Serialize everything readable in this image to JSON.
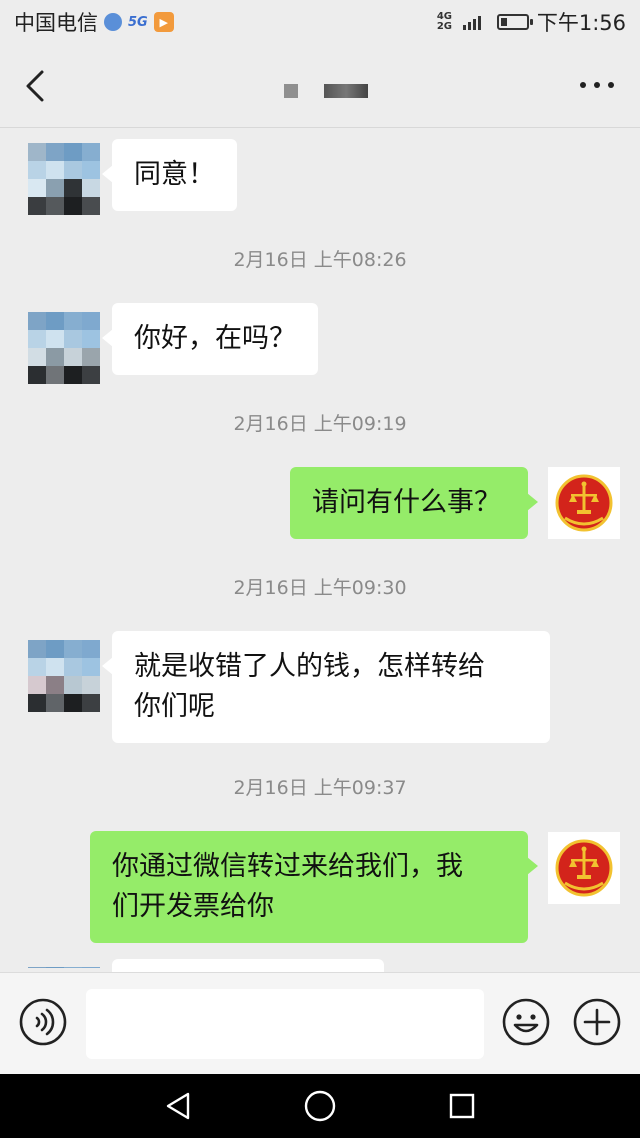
{
  "status_bar": {
    "carrier": "中国电信",
    "network_top": "4G",
    "network_bottom": "2G",
    "time": "下午1:56",
    "battery_level": 0.25
  },
  "header": {
    "back_icon": "chevron-left-icon",
    "more_icon": "more-dots-icon"
  },
  "messages": [
    {
      "side": "in",
      "text": "同意！"
    },
    {
      "type": "time",
      "text": "2月16日 上午08:26"
    },
    {
      "side": "in",
      "text": "你好，在吗？"
    },
    {
      "type": "time",
      "text": "2月16日 上午09:19"
    },
    {
      "side": "out",
      "text": "请问有什么事？"
    },
    {
      "type": "time",
      "text": "2月16日 上午09:30"
    },
    {
      "side": "in",
      "line1": "就是收错了人的钱，怎样转给",
      "line2": "你们呢"
    },
    {
      "type": "time",
      "text": "2月16日 上午09:37"
    },
    {
      "side": "out",
      "line1": "你通过微信转过来给我们，我",
      "line2": "们开发票给你"
    }
  ],
  "input_bar": {
    "voice_icon": "voice-icon",
    "input_value": "",
    "emoji_icon": "emoji-icon",
    "plus_icon": "plus-icon"
  },
  "colors": {
    "chat_background": "#ededed",
    "outgoing_bubble": "#95ec69",
    "incoming_bubble": "#ffffff",
    "emblem_red": "#d3241b",
    "emblem_gold": "#f2c230"
  }
}
